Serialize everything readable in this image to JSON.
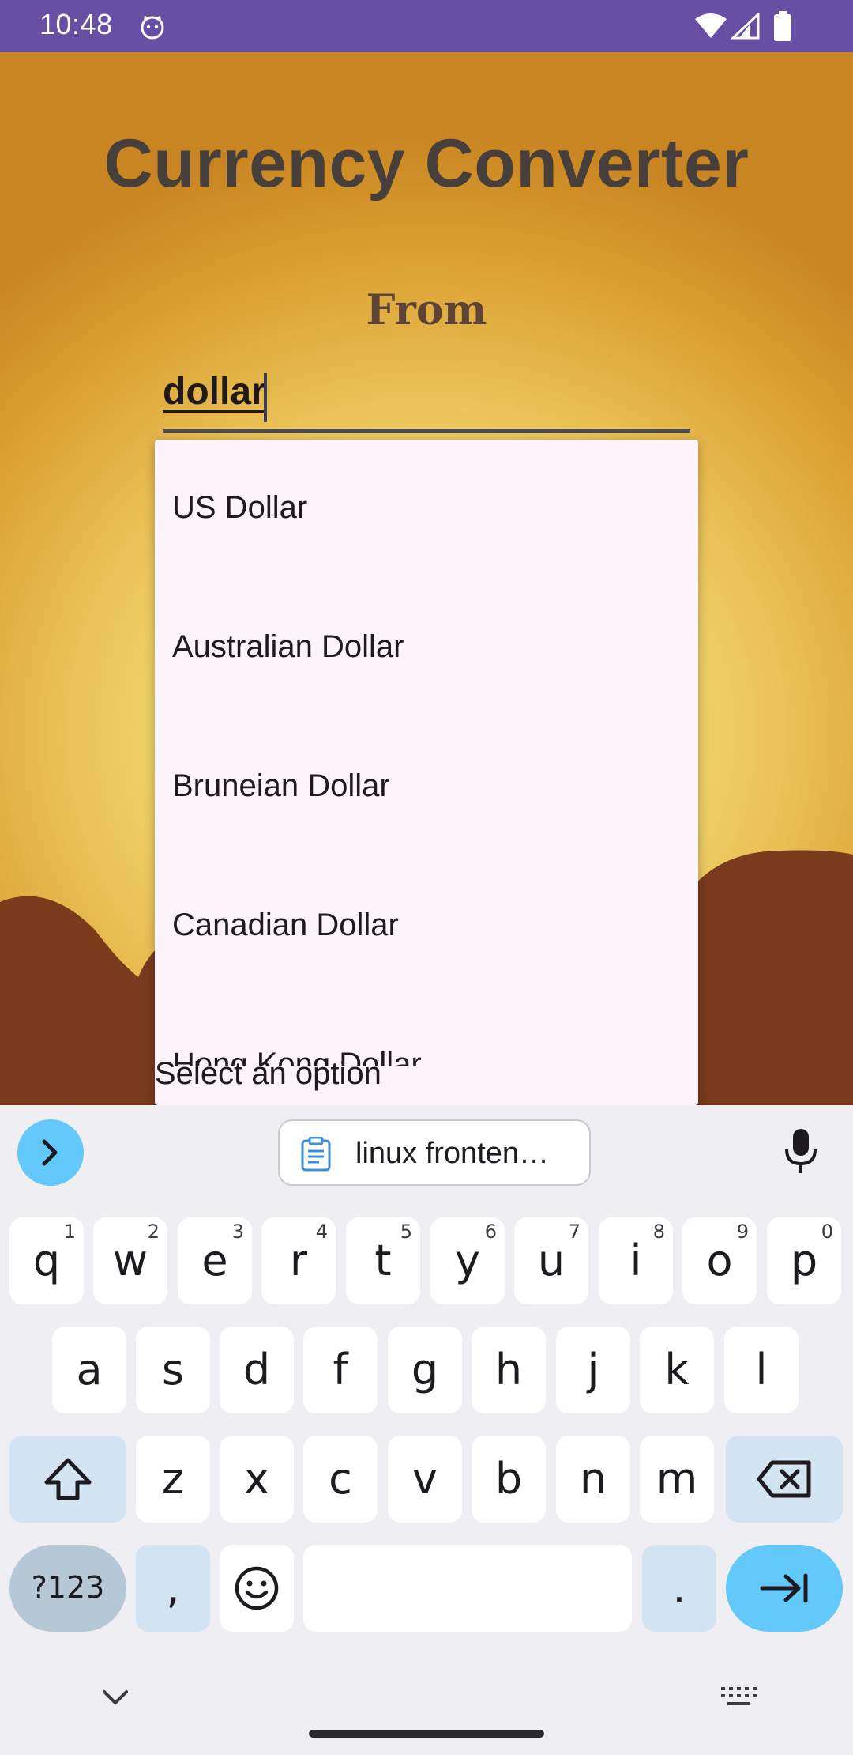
{
  "status_bar": {
    "time": "10:48",
    "app_icon": "cat-face-icon",
    "icons": [
      "wifi-icon",
      "cellular-signal-icon",
      "battery-icon"
    ],
    "color": "#6750a4"
  },
  "app": {
    "title": "Currency Converter",
    "from_label": "From",
    "from_input": {
      "value": "dollar"
    }
  },
  "dropdown": {
    "options": [
      "US Dollar",
      "Australian Dollar",
      "Bruneian Dollar",
      "Canadian Dollar",
      "Hong Kong Dollar"
    ],
    "hint": "Select an option"
  },
  "keyboard": {
    "expand_icon": "chevron-right-icon",
    "clipboard_suggestion": "linux fronten…",
    "mic_icon": "microphone-icon",
    "row1": [
      {
        "key": "q",
        "hint": "1"
      },
      {
        "key": "w",
        "hint": "2"
      },
      {
        "key": "e",
        "hint": "3"
      },
      {
        "key": "r",
        "hint": "4"
      },
      {
        "key": "t",
        "hint": "5"
      },
      {
        "key": "y",
        "hint": "6"
      },
      {
        "key": "u",
        "hint": "7"
      },
      {
        "key": "i",
        "hint": "8"
      },
      {
        "key": "o",
        "hint": "9"
      },
      {
        "key": "p",
        "hint": "0"
      }
    ],
    "row2": [
      "a",
      "s",
      "d",
      "f",
      "g",
      "h",
      "j",
      "k",
      "l"
    ],
    "row3": [
      "z",
      "x",
      "c",
      "v",
      "b",
      "n",
      "m"
    ],
    "symbols_key": "?123",
    "comma_key": ",",
    "period_key": ".",
    "accent_color": "#63c8fa",
    "function_key_color": "#d2e3f2"
  }
}
